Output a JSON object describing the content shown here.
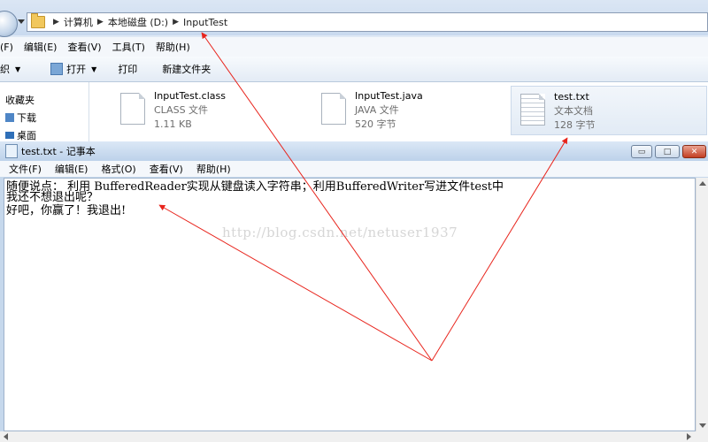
{
  "explorer": {
    "breadcrumb": [
      "计算机",
      "本地磁盘 (D:)",
      "InputTest"
    ],
    "menu": [
      "(F)",
      "编辑(E)",
      "查看(V)",
      "工具(T)",
      "帮助(H)"
    ],
    "toolbar": {
      "organize": "织",
      "open": "打开",
      "print": "打印",
      "new_folder": "新建文件夹"
    },
    "sidebar": {
      "favorites": "收藏夹",
      "downloads": "下载",
      "desktop": "桌面"
    },
    "files": [
      {
        "name": "InputTest.class",
        "type": "CLASS 文件",
        "size": "1.11 KB",
        "icon": "class-file-icon",
        "selected": false
      },
      {
        "name": "InputTest.java",
        "type": "JAVA 文件",
        "size": "520 字节",
        "icon": "java-file-icon",
        "selected": false
      },
      {
        "name": "test.txt",
        "type": "文本文档",
        "size": "128 字节",
        "icon": "text-file-icon",
        "selected": true
      }
    ]
  },
  "notepad": {
    "title": "test.txt - 记事本",
    "menu": [
      "文件(F)",
      "编辑(E)",
      "格式(O)",
      "查看(V)",
      "帮助(H)"
    ],
    "lines": [
      "随便说点： 利用 BufferedReader实现从键盘读入字符串；利用BufferedWriter写进文件test中",
      "我还不想退出呢？",
      "好吧，你赢了！我退出!"
    ],
    "watermark": "http://blog.csdn.net/netuser1937",
    "buttons": {
      "minimize": "▭",
      "maximize": "□",
      "close": "✕"
    }
  },
  "annotation": {
    "arrow_color": "#e8241c"
  }
}
